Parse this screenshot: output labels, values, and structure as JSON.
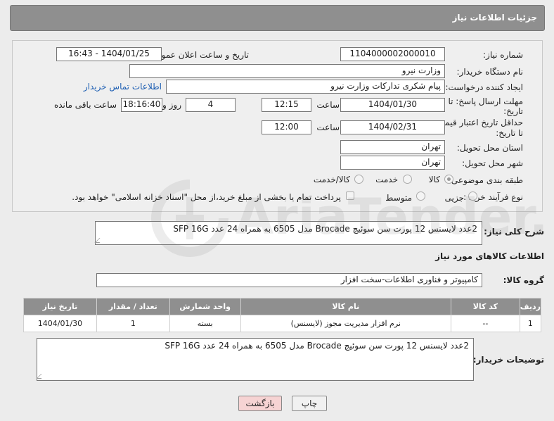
{
  "header": {
    "title": "جزئیات اطلاعات نیاز"
  },
  "form": {
    "need_number_label": "شماره نیاز:",
    "need_number": "1104000002000010",
    "announce_label": "تاریخ و ساعت اعلان عمومی:",
    "announce_value": "1404/01/25 - 16:43",
    "buyer_org_label": "نام دستگاه خریدار:",
    "buyer_org": "وزارت نیرو",
    "creator_label": "ایجاد کننده درخواست:",
    "creator": "پیام شکری تدارکات وزارت نیرو",
    "contact_link": "اطلاعات تماس خریدار",
    "deadline_label_1": "مهلت ارسال پاسخ: تا",
    "deadline_label_2": "تاریخ:",
    "deadline_date": "1404/01/30",
    "time_label": "ساعت",
    "deadline_time": "12:15",
    "days_value": "4",
    "days_label": "روز و",
    "remaining_time": "18:16:40",
    "remaining_label": "ساعت باقی مانده",
    "price_label_1": "حداقل تاریخ اعتبار قیمت:",
    "price_label_2": "تا تاریخ:",
    "price_date": "1404/02/31",
    "price_time": "12:00",
    "province_label": "استان محل تحویل:",
    "province": "تهران",
    "city_label": "شهر محل تحویل:",
    "city": "تهران",
    "category_label": "طبقه بندی موضوعی:",
    "category_options": [
      "کالا",
      "خدمت",
      "کالا/خدمت"
    ],
    "category_selected": "کالا",
    "process_label": "نوع فرآیند خرید :",
    "process_options": [
      "جزیی",
      "متوسط"
    ],
    "payment_text": "پرداخت تمام یا بخشی از مبلغ خرید،از محل \"اسناد خزانه اسلامی\" خواهد بود."
  },
  "summary": {
    "label": "شرح کلی نیاز:",
    "text": "2عدد لایسنس 12 پورت سن سوئیچ Brocade مدل 6505 به همراه 24 عدد SFP 16G"
  },
  "goods_section": {
    "title": "اطلاعات کالاهای مورد نیاز",
    "group_label": "گروه کالا:",
    "group_value": "کامپیوتر و فناوری اطلاعات-سخت افزار"
  },
  "table": {
    "headers": [
      "ردیف",
      "کد کالا",
      "نام کالا",
      "واحد شمارش",
      "تعداد / مقدار",
      "تاریخ نیاز"
    ],
    "rows": [
      {
        "row": "1",
        "code": "--",
        "name": "نرم افزار مدیریت مجوز (لایسنس)",
        "unit": "بسته",
        "qty": "1",
        "date": "1404/01/30"
      }
    ]
  },
  "buyer_notes": {
    "label": "توضیحات خریدار:",
    "text": "2عدد لایسنس 12 پورت سن سوئیچ Brocade مدل 6505 به همراه 24 عدد SFP 16G"
  },
  "buttons": {
    "print": "چاپ",
    "back": "بازگشت"
  },
  "watermark": {
    "text": "AriaTender.neT"
  },
  "colors": {
    "header_bg": "#8f8f8f",
    "link": "#1e5fb3",
    "back_button_bg": "#f6d3d3"
  }
}
